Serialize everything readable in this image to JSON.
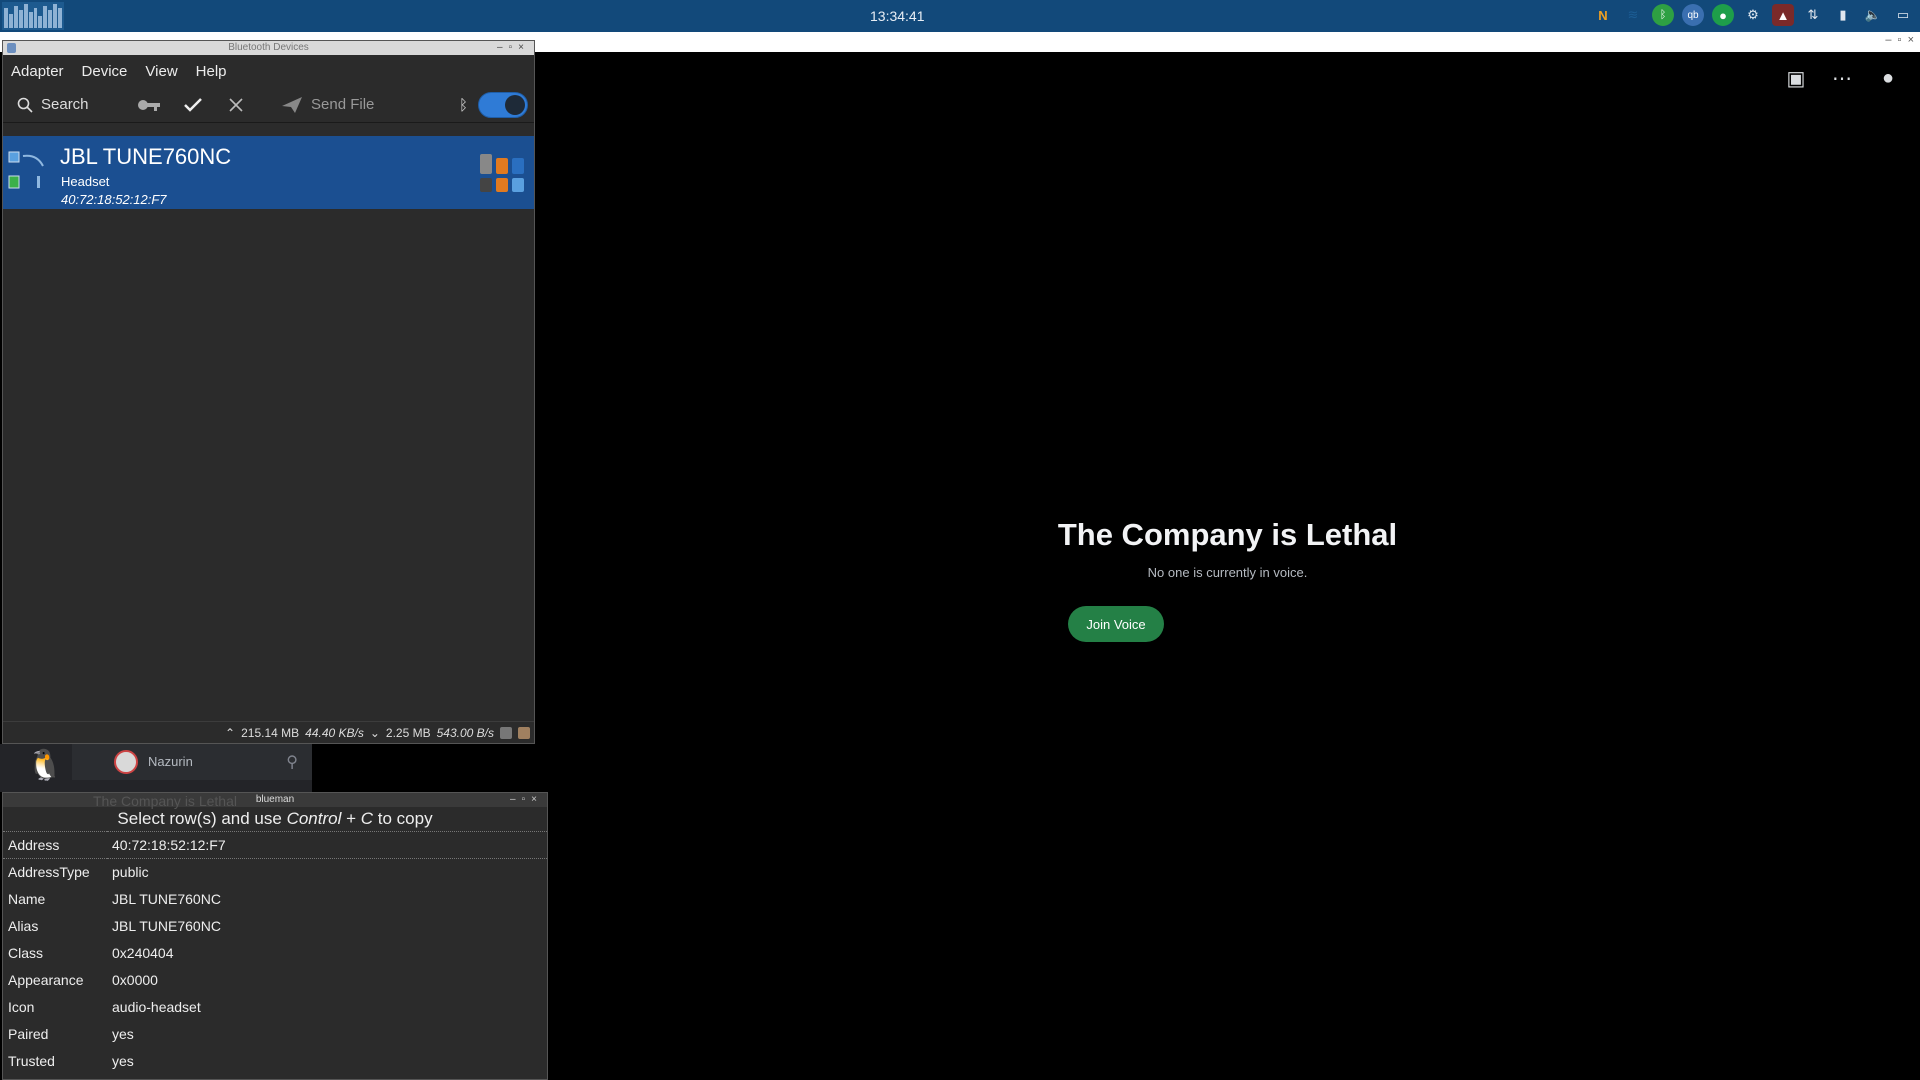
{
  "panel": {
    "clock": "13:34:41",
    "tray_icons": [
      "nextcloud-icon",
      "wifi-icon",
      "bluetooth-icon",
      "qbittorrent-icon",
      "circle-icon",
      "steam-icon",
      "game-icon",
      "network-icon",
      "usb-icon",
      "volume-icon",
      "window-icon"
    ]
  },
  "discord": {
    "channel_title": "The Company is Lethal",
    "voice_status": "No one is currently in voice.",
    "join_label": "Join Voice",
    "user_name": "Nazurin",
    "ghost_channel": "The Company is Lethal"
  },
  "bluetooth": {
    "window_title": "Bluetooth Devices",
    "menu": [
      "Adapter",
      "Device",
      "View",
      "Help"
    ],
    "toolbar": {
      "search_label": "Search",
      "send_file_label": "Send File"
    },
    "device": {
      "name": "JBL TUNE760NC",
      "type": "Headset",
      "address": "40:72:18:52:12:F7"
    },
    "status": {
      "upload_total": "215.14 MB",
      "upload_rate": "44.40 KB/s",
      "download_total": "2.25 MB",
      "download_rate": "543.00 B/s"
    }
  },
  "info": {
    "window_title": "blueman",
    "hint_prefix": "Select row(s) and use ",
    "hint_key1": "Control",
    "hint_plus": " + ",
    "hint_key2": "C",
    "hint_suffix": " to copy",
    "rows": [
      {
        "key": "Address",
        "value": "40:72:18:52:12:F7"
      },
      {
        "key": "AddressType",
        "value": "public"
      },
      {
        "key": "Name",
        "value": "JBL TUNE760NC"
      },
      {
        "key": "Alias",
        "value": "JBL TUNE760NC"
      },
      {
        "key": "Class",
        "value": "0x240404"
      },
      {
        "key": "Appearance",
        "value": "0x0000"
      },
      {
        "key": "Icon",
        "value": "audio-headset"
      },
      {
        "key": "Paired",
        "value": "yes"
      },
      {
        "key": "Trusted",
        "value": "yes"
      }
    ]
  },
  "colors": {
    "panel": "#12497a",
    "selection": "#1b4f91",
    "join_button": "#248046",
    "toggle": "#2f7bd6"
  }
}
